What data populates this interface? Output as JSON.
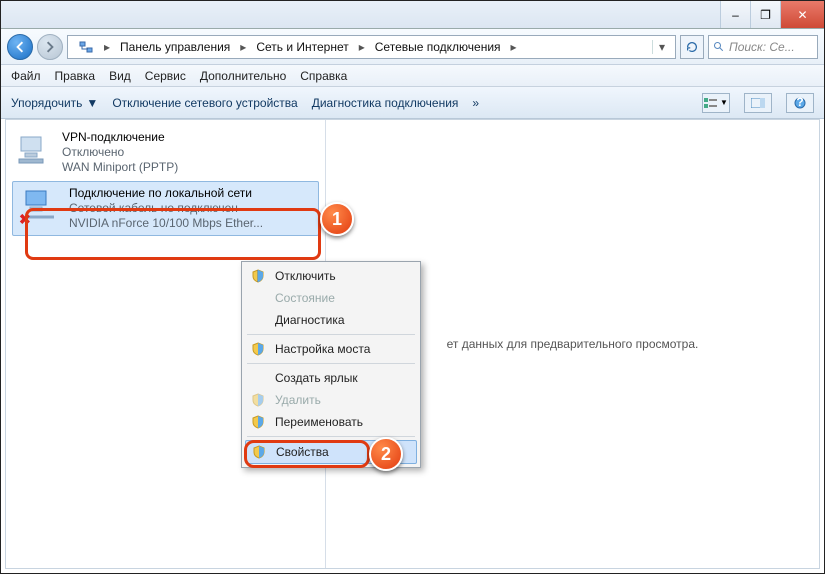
{
  "titlebar": {
    "min": "–",
    "max": "❐",
    "close": "✕"
  },
  "address": {
    "crumbs": [
      "Панель управления",
      "Сеть и Интернет",
      "Сетевые подключения"
    ],
    "search_placeholder": "Поиск: Се..."
  },
  "menubar": [
    "Файл",
    "Правка",
    "Вид",
    "Сервис",
    "Дополнительно",
    "Справка"
  ],
  "toolbar": {
    "organize": "Упорядочить",
    "disable": "Отключение сетевого устройства",
    "diagnose": "Диагностика подключения",
    "more": "»"
  },
  "connections": [
    {
      "title": "VPN-подключение",
      "status": "Отключено",
      "device": "WAN Miniport (PPTP)",
      "selected": false,
      "error": false
    },
    {
      "title": "Подключение по локальной сети",
      "status": "Сетевой кабель не подключен",
      "device": "NVIDIA nForce 10/100 Mbps Ether...",
      "selected": true,
      "error": true
    }
  ],
  "preview_text": "ет данных для предварительного просмотра.",
  "context_menu": {
    "items": [
      {
        "label": "Отключить",
        "shield": true,
        "disabled": false
      },
      {
        "label": "Состояние",
        "shield": false,
        "disabled": true
      },
      {
        "label": "Диагностика",
        "shield": false,
        "disabled": false
      }
    ],
    "items2": [
      {
        "label": "Настройка моста",
        "shield": true,
        "disabled": false
      }
    ],
    "items3": [
      {
        "label": "Создать ярлык",
        "shield": false,
        "disabled": false
      },
      {
        "label": "Удалить",
        "shield": true,
        "disabled": true
      },
      {
        "label": "Переименовать",
        "shield": true,
        "disabled": false
      }
    ],
    "items4": [
      {
        "label": "Свойства",
        "shield": true,
        "disabled": false,
        "hover": true
      }
    ]
  },
  "badges": {
    "b1": "1",
    "b2": "2"
  }
}
